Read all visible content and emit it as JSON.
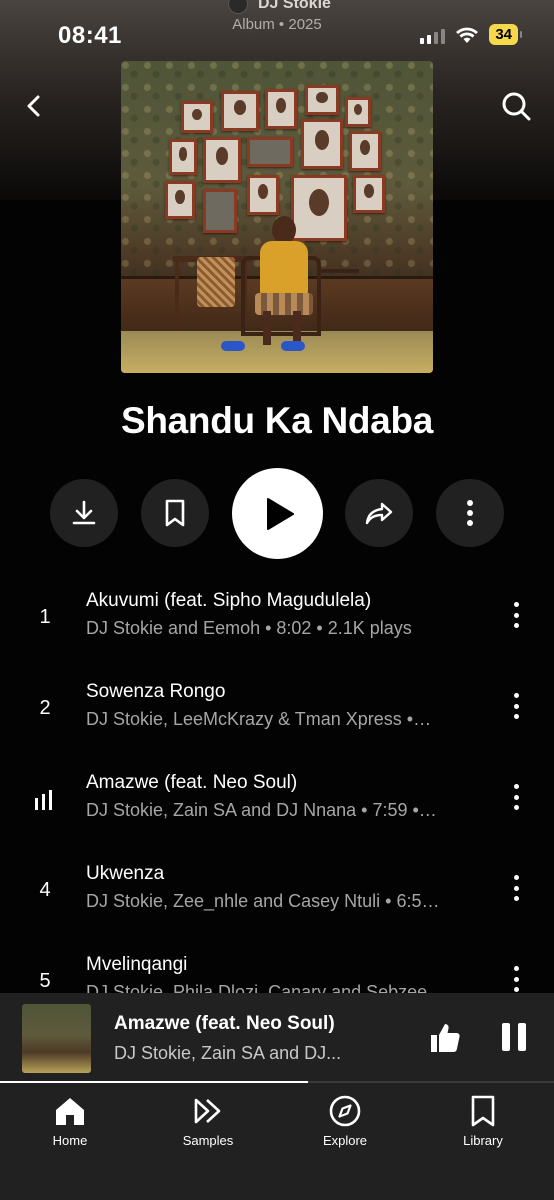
{
  "status_bar": {
    "time": "08:41",
    "battery": "34"
  },
  "header": {
    "artist": "DJ Stokie",
    "meta": "Album • 2025"
  },
  "album": {
    "title": "Shandu Ka Ndaba"
  },
  "actions": {
    "download": "download-icon",
    "save": "bookmark-icon",
    "play": "play-icon",
    "share": "share-icon",
    "more": "more-vertical-icon"
  },
  "tracks": [
    {
      "num": "1",
      "title": "Akuvumi (feat. Sipho Magudulela)",
      "subtitle": "DJ Stokie and Eemoh • 8:02 • 2.1K plays",
      "playing": false
    },
    {
      "num": "2",
      "title": "Sowenza Rongo",
      "subtitle": "DJ Stokie, LeeMcKrazy & Tman Xpress •…",
      "playing": false
    },
    {
      "num": "",
      "title": "Amazwe (feat. Neo Soul)",
      "subtitle": "DJ Stokie, Zain SA and DJ Nnana • 7:59 •…",
      "playing": true
    },
    {
      "num": "4",
      "title": "Ukwenza",
      "subtitle": "DJ Stokie, Zee_nhle and Casey Ntuli • 6:5…",
      "playing": false
    },
    {
      "num": "5",
      "title": "Mvelinqangi",
      "subtitle": "DJ Stokie, Phila Dlozi, Canary and Sebzee",
      "playing": false
    }
  ],
  "now_playing": {
    "title": "Amazwe (feat. Neo Soul)",
    "subtitle": "DJ Stokie, Zain SA and DJ...",
    "progress": 0.556
  },
  "nav": {
    "home": "Home",
    "samples": "Samples",
    "explore": "Explore",
    "library": "Library"
  },
  "colors": {
    "background": "#030303",
    "surface": "#212121",
    "battery": "#f5d94a",
    "secondary_text": "#a6a6a6"
  }
}
